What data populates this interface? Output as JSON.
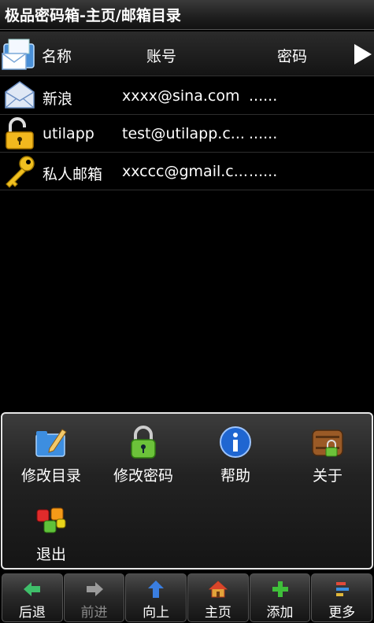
{
  "title": "极品密码箱-主页/邮箱目录",
  "header": {
    "icon": "mail-folder-icon",
    "col_name": "名称",
    "col_account": "账号",
    "col_password": "密码",
    "play_icon": "play-arrow-icon"
  },
  "rows": [
    {
      "icon": "envelope-icon",
      "name": "新浪",
      "account": "xxxx@sina.com",
      "password": "......"
    },
    {
      "icon": "open-padlock-icon",
      "name": "utilapp",
      "account": "test@utilapp.c...",
      "password": "......"
    },
    {
      "icon": "key-icon",
      "name": "私人邮箱",
      "account": "xxccc@gmail.c...",
      "password": "......"
    }
  ],
  "menu": {
    "items": [
      {
        "icon": "edit-folder-icon",
        "label": "修改目录"
      },
      {
        "icon": "green-padlock-icon",
        "label": "修改密码"
      },
      {
        "icon": "info-icon",
        "label": "帮助"
      },
      {
        "icon": "safe-box-icon",
        "label": "关于"
      },
      {
        "icon": "cubes-exit-icon",
        "label": "退出"
      }
    ]
  },
  "toolbar": {
    "items": [
      {
        "icon": "arrow-left-icon",
        "label": "后退",
        "disabled": false
      },
      {
        "icon": "arrow-right-icon",
        "label": "前进",
        "disabled": true
      },
      {
        "icon": "arrow-up-icon",
        "label": "向上",
        "disabled": false
      },
      {
        "icon": "home-icon",
        "label": "主页",
        "disabled": false
      },
      {
        "icon": "plus-icon",
        "label": "添加",
        "disabled": false
      },
      {
        "icon": "more-icon",
        "label": "更多",
        "disabled": false
      }
    ]
  }
}
